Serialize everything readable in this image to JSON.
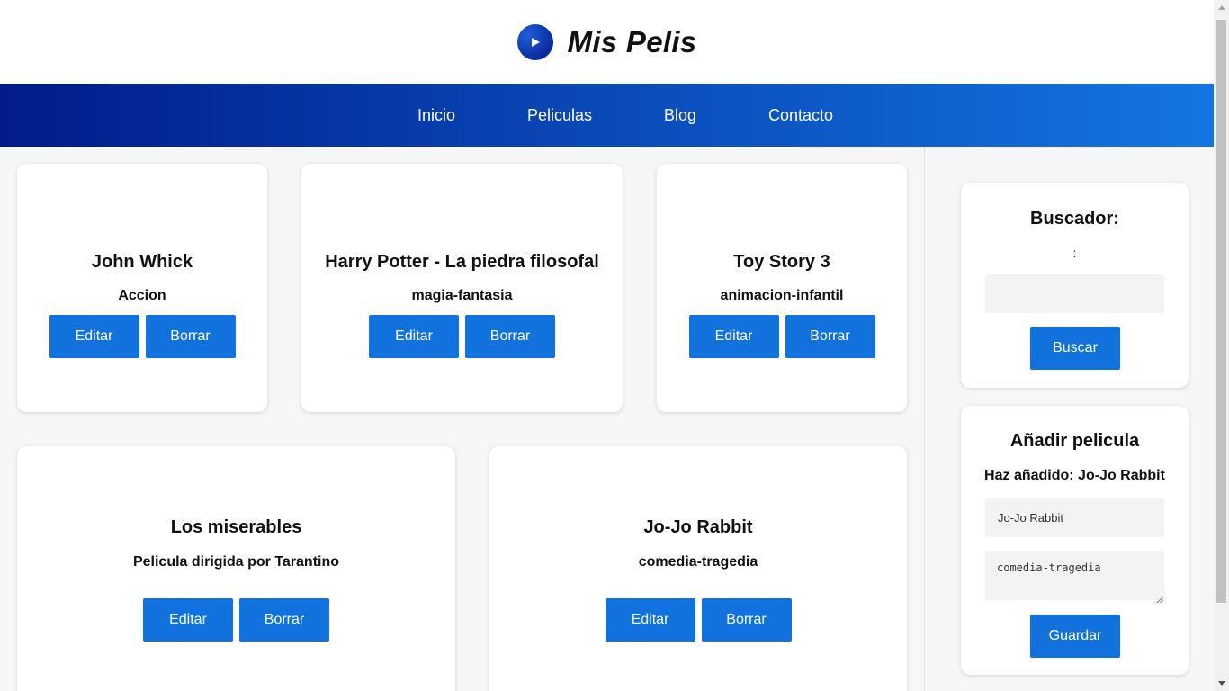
{
  "brand": {
    "title": "Mis Pelis",
    "logo_icon": "play-circle-icon"
  },
  "nav": {
    "items": [
      {
        "label": "Inicio"
      },
      {
        "label": "Peliculas"
      },
      {
        "label": "Blog"
      },
      {
        "label": "Contacto"
      }
    ]
  },
  "movies": [
    {
      "title": "John Whick",
      "genre": "Accion",
      "edit_label": "Editar",
      "delete_label": "Borrar"
    },
    {
      "title": "Harry Potter - La piedra filosofal",
      "genre": "magia-fantasia",
      "edit_label": "Editar",
      "delete_label": "Borrar"
    },
    {
      "title": "Toy Story 3",
      "genre": "animacion-infantil",
      "edit_label": "Editar",
      "delete_label": "Borrar"
    },
    {
      "title": "Los miserables",
      "genre": "Pelicula dirigida por Tarantino",
      "edit_label": "Editar",
      "delete_label": "Borrar"
    },
    {
      "title": "Jo-Jo Rabbit",
      "genre": "comedia-tragedia",
      "edit_label": "Editar",
      "delete_label": "Borrar"
    }
  ],
  "search": {
    "title": "Buscador:",
    "colon": ":",
    "value": "",
    "button_label": "Buscar"
  },
  "add_movie": {
    "title": "Añadir pelicula",
    "added_message": "Haz añadido: Jo-Jo Rabbit",
    "title_value": "Jo-Jo Rabbit",
    "description_value": "comedia-tragedia",
    "button_label": "Guardar"
  },
  "colors": {
    "primary_button": "#1172dd",
    "nav_gradient_start": "#021b8a",
    "nav_gradient_end": "#1375e3"
  }
}
